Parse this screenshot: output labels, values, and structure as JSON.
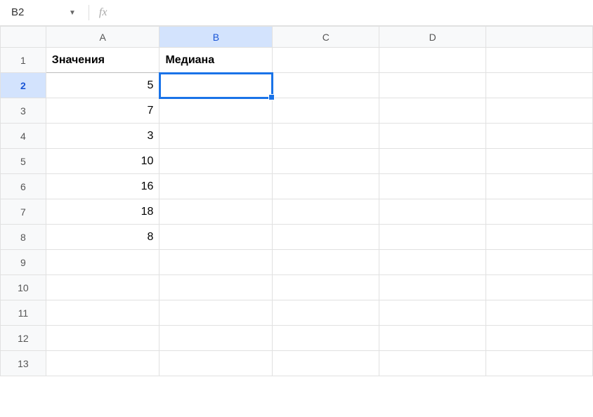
{
  "namebox": {
    "value": "B2"
  },
  "formula_bar": {
    "fx_label": "fx",
    "value": ""
  },
  "columns": [
    "A",
    "B",
    "C",
    "D",
    ""
  ],
  "column_selected_index": 1,
  "rows_visible": 13,
  "row_selected_index": 2,
  "active_cell": {
    "row": 2,
    "col": 1
  },
  "cells": {
    "A1": {
      "v": "Значения",
      "header": true
    },
    "B1": {
      "v": "Медиана",
      "header": true
    },
    "A2": {
      "v": "5",
      "num": true
    },
    "A3": {
      "v": "7",
      "num": true
    },
    "A4": {
      "v": "3",
      "num": true
    },
    "A5": {
      "v": "10",
      "num": true
    },
    "A6": {
      "v": "16",
      "num": true
    },
    "A7": {
      "v": "18",
      "num": true
    },
    "A8": {
      "v": "8",
      "num": true
    }
  },
  "chart_data": {
    "type": "table",
    "title": "",
    "columns": [
      "Значения",
      "Медиана"
    ],
    "rows": [
      [
        5,
        null
      ],
      [
        7,
        null
      ],
      [
        3,
        null
      ],
      [
        10,
        null
      ],
      [
        16,
        null
      ],
      [
        18,
        null
      ],
      [
        8,
        null
      ]
    ]
  }
}
